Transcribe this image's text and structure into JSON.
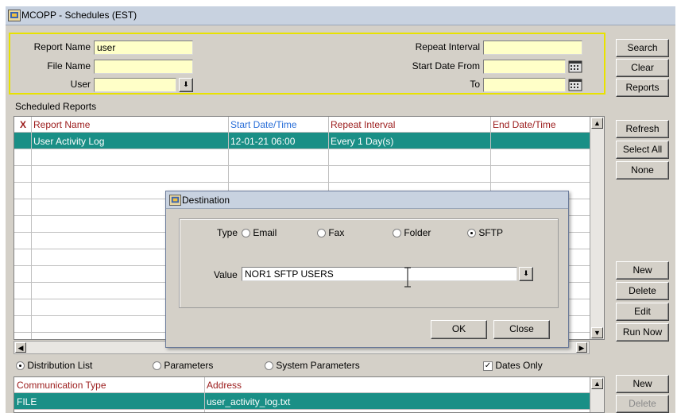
{
  "window": {
    "title": "MCOPP - Schedules (EST)"
  },
  "search": {
    "report_name_label": "Report Name",
    "report_name_value": "user",
    "file_name_label": "File Name",
    "file_name_value": "",
    "user_label": "User",
    "user_value": "",
    "repeat_interval_label": "Repeat Interval",
    "repeat_interval_value": "",
    "start_date_from_label": "Start Date From",
    "start_date_from_value": "",
    "to_label": "To",
    "to_value": ""
  },
  "right_buttons_top": [
    {
      "label": "Search"
    },
    {
      "label": "Clear"
    },
    {
      "label": "Reports"
    }
  ],
  "scheduled": {
    "section_label": "Scheduled Reports",
    "columns": [
      "X",
      "Report Name",
      "Start Date/Time",
      "Repeat Interval",
      "End Date/Time"
    ],
    "rows": [
      {
        "report_name": "User Activity Log",
        "start": "12-01-21 06:00",
        "repeat": "Every 1 Day(s)",
        "end": ""
      }
    ]
  },
  "right_buttons_mid": [
    {
      "label": "Refresh"
    },
    {
      "label": "Select All"
    },
    {
      "label": "None"
    }
  ],
  "right_buttons_low": [
    {
      "label": "New"
    },
    {
      "label": "Delete"
    },
    {
      "label": "Edit"
    },
    {
      "label": "Run Now"
    }
  ],
  "options": {
    "distribution_list": "Distribution List",
    "parameters": "Parameters",
    "system_parameters": "System Parameters",
    "dates_only": "Dates Only",
    "selected": "distribution_list",
    "dates_only_checked": true
  },
  "communication": {
    "columns": [
      "Communication Type",
      "Address"
    ],
    "rows": [
      {
        "type": "FILE",
        "address": "user_activity_log.txt"
      }
    ]
  },
  "right_buttons_bottom": [
    {
      "label": "New"
    },
    {
      "label": "Delete"
    }
  ],
  "dialog": {
    "title": "Destination",
    "type_label": "Type",
    "type_options": [
      "Email",
      "Fax",
      "Folder",
      "SFTP"
    ],
    "type_selected": "SFTP",
    "value_label": "Value",
    "value": "NOR1 SFTP USERS",
    "ok_label": "OK",
    "close_label": "Close"
  },
  "colors": {
    "selected_row": "#1a8f86",
    "input_bg": "#ffffc8",
    "header_red": "#9b1b1b",
    "header_blue": "#2a6fd8",
    "search_border": "#e8e200"
  }
}
